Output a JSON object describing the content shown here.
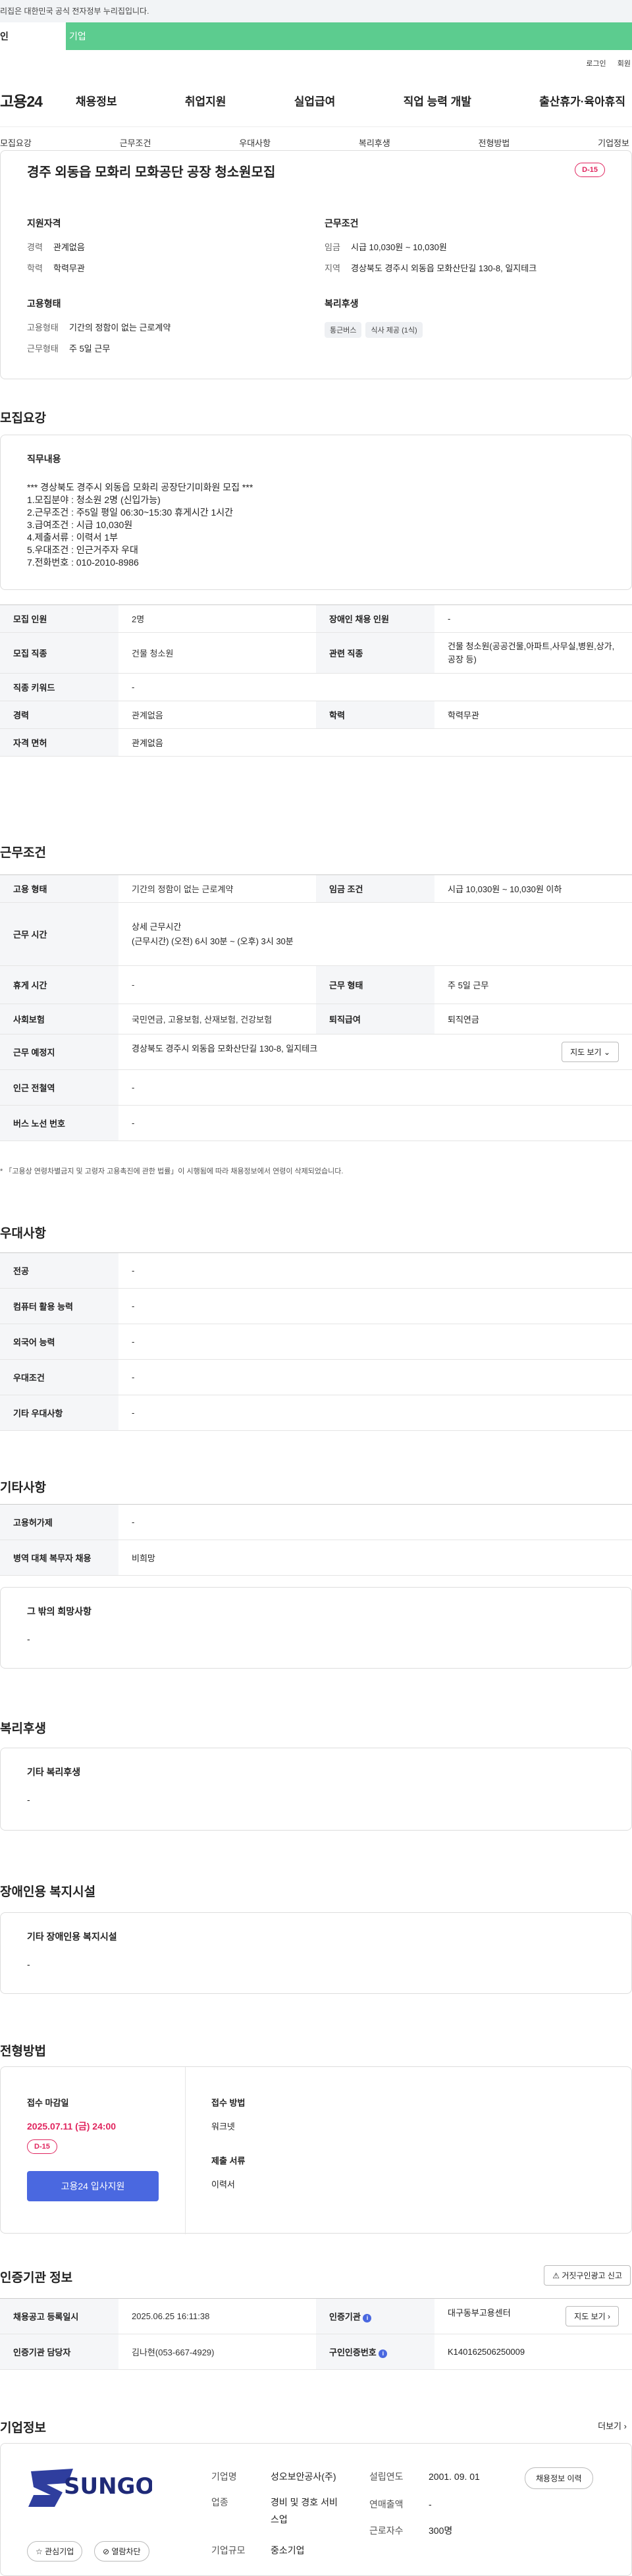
{
  "gov_banner": "리집은 대한민국 공식 전자정부 누리집입니다.",
  "user_tabs": [
    "인",
    "기업"
  ],
  "util": {
    "login": "로그인",
    "join": "회원"
  },
  "logo": "고용24",
  "gnb": [
    "채용정보",
    "취업지원",
    "실업급여",
    "직업 능력 개발",
    "출산휴가·육아휴직"
  ],
  "anchor": [
    "모집요강",
    "근무조건",
    "우대사항",
    "복리후생",
    "전형방법",
    "기업정보"
  ],
  "job": {
    "title": "경주 외동읍 모화리 모화공단 공장 청소원모집",
    "dday": "D-15",
    "qual_h": "지원자격",
    "career_k": "경력",
    "career_v": "관계없음",
    "edu_k": "학력",
    "edu_v": "학력무관",
    "cond_h": "근무조건",
    "wage_k": "임금",
    "wage_v": "시급 10,030원 ~ 10,030원",
    "area_k": "지역",
    "area_v": "경상북도 경주시 외동읍 모화산단길 130-8, 일지테크",
    "emp_h": "고용형태",
    "emptype_k": "고용형태",
    "emptype_v": "기간의 정함이 없는 근로계약",
    "workform_k": "근무형태",
    "workform_v": "주 5일 근무",
    "welfare_h": "복리후생",
    "tags": [
      "통근버스",
      "식사 제공 (1식)"
    ]
  },
  "recruit": {
    "title": "모집요강",
    "duty_h": "직무내용",
    "duty_text": "*** 경상북도 경주시 외동읍 모화리 공장단기미화원 모집 ***\n1.모집분야 : 청소원 2명 (신입가능)\n2.근무조건 : 주5일 평일 06:30~15:30 휴게시간 1시간\n3.급여조건 : 시급 10,030원\n4.제출서류 : 이력서 1부\n5.우대조건 : 인근거주자 우대\n7.전화번호 : 010-2010-8986",
    "rows": [
      [
        "모집 인원",
        "2명",
        "장애인 채용 인원",
        "-"
      ],
      [
        "모집 직종",
        "건물 청소원",
        "관련 직종",
        "건물 청소원(공공건물,아파트,사무실,병원,상가,공장 등)"
      ],
      [
        "직종 키워드",
        "-"
      ],
      [
        "경력",
        "관계없음",
        "학력",
        "학력무관"
      ],
      [
        "자격 면허",
        "관계없음"
      ]
    ]
  },
  "work": {
    "title": "근무조건",
    "r1": [
      "고용 형태",
      "기간의 정함이 없는 근로계약",
      "임금 조건",
      "시급 10,030원 ~ 10,030원 이하"
    ],
    "r2_h": "근무 시간",
    "r2_sub": "상세 근무시간",
    "r2_v": "(근무시간) (오전) 6시 30분 ~ (오후) 3시 30분",
    "r3": [
      "휴게 시간",
      "-",
      "근무 형태",
      "주 5일 근무"
    ],
    "r4": [
      "사회보험",
      "국민연금, 고용보험, 산재보험, 건강보험",
      "퇴직급여",
      "퇴직연금"
    ],
    "r5_h": "근무 예정지",
    "r5_v": "경상북도 경주시 외동읍 모화산단길 130-8, 일지테크",
    "map_btn": "지도 보기",
    "r6": [
      "인근 전철역",
      "-"
    ],
    "r7": [
      "버스 노선 번호",
      "-"
    ],
    "note": "* 「고용상 연령차별금지 및 고령자 고용촉진에 관한 법률」이 시행됨에 따라 채용정보에서 연령이 삭제되었습니다."
  },
  "pref": {
    "title": "우대사항",
    "rows": [
      [
        "전공",
        "-"
      ],
      [
        "컴퓨터 활용 능력",
        "-"
      ],
      [
        "외국어 능력",
        "-"
      ],
      [
        "우대조건",
        "-"
      ],
      [
        "기타 우대사항",
        "-"
      ]
    ]
  },
  "etc": {
    "title": "기타사항",
    "rows": [
      [
        "고용허가제",
        "-"
      ],
      [
        "병역 대체 복무자 채용",
        "비희망"
      ]
    ],
    "other_h": "그 밖의 희망사항",
    "other_v": "-"
  },
  "welfare": {
    "title": "복리후생",
    "h": "기타 복리후생",
    "v": "-"
  },
  "disab": {
    "title": "장애인용 복지시설",
    "h": "기타 장애인용 복지시설",
    "v": "-"
  },
  "apply": {
    "title": "전형방법",
    "deadline_h": "접수 마감일",
    "deadline_v": "2025.07.11 (금) 24:00",
    "dday": "D-15",
    "btn": "고용24 입사지원",
    "method_h": "접수 방법",
    "method_v": "워크넷",
    "docs_h": "제출 서류",
    "docs_v": "이력서"
  },
  "cert": {
    "title": "인증기관 정보",
    "report_btn": "거짓구인광고 신고",
    "r1": [
      "채용공고 등록일시",
      "2025.06.25 16:11:38",
      "인증기관",
      "대구동부고용센터"
    ],
    "r2": [
      "인증기관 담당자",
      "김나현(053-667-4929)",
      "구인인증번호",
      "K140162506250009"
    ],
    "map_btn": "지도 보기"
  },
  "company": {
    "title": "기업정보",
    "more": "더보기",
    "logo": "SUNGO",
    "fav": "관심기업",
    "block": "열람차단",
    "k1": "기업명",
    "v1": "성오보안공사(주)",
    "k2": "업종",
    "v2": "경비 및 경호 서비스업",
    "k3": "기업규모",
    "v3": "중소기업",
    "k4": "설립연도",
    "v4": "2001. 09. 01",
    "k5": "연매출액",
    "v5": "-",
    "k6": "근로자수",
    "v6": "300명",
    "history_btn": "채용정보 이력"
  }
}
